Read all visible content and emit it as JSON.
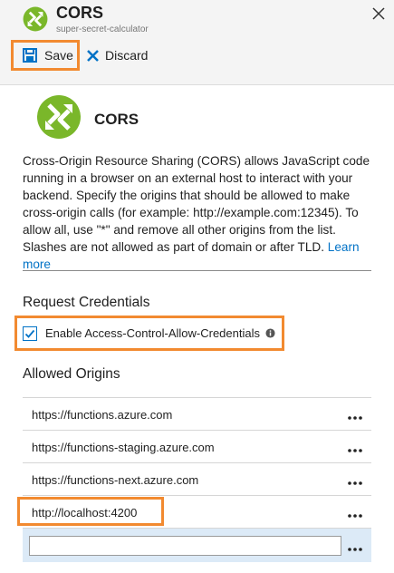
{
  "header": {
    "title": "CORS",
    "subtitle": "super-secret-calculator"
  },
  "toolbar": {
    "save_label": "Save",
    "discard_label": "Discard"
  },
  "hero": {
    "title": "CORS"
  },
  "description": {
    "text": "Cross-Origin Resource Sharing (CORS) allows JavaScript code running in a browser on an external host to interact with your backend. Specify the origins that should be allowed to make cross-origin calls (for example: http://example.com:12345). To allow all, use \"*\" and remove all other origins from the list. Slashes are not allowed as part of domain or after TLD.",
    "link_label": "Learn more"
  },
  "credentials": {
    "section_title": "Request Credentials",
    "checkbox_label": "Enable Access-Control-Allow-Credentials",
    "checked": true
  },
  "origins": {
    "section_title": "Allowed Origins",
    "items": [
      {
        "url": "https://functions.azure.com"
      },
      {
        "url": "https://functions-staging.azure.com"
      },
      {
        "url": "https://functions-next.azure.com"
      },
      {
        "url": "http://localhost:4200"
      }
    ],
    "new_value": ""
  },
  "colors": {
    "accent_blue": "#0072c6",
    "highlight_orange": "#f28a30",
    "logo_green": "#7ab72a",
    "new_row_bg": "#dceaf7"
  }
}
